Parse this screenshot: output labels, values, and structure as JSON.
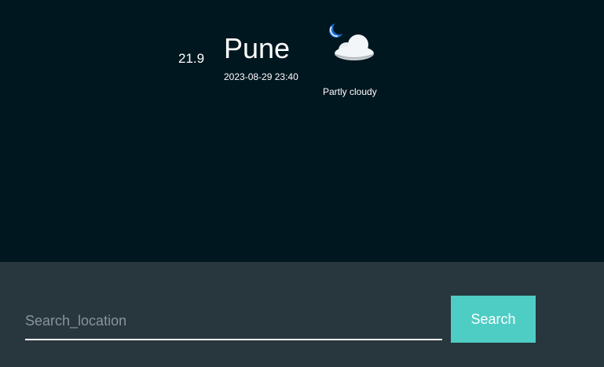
{
  "weather": {
    "temperature": "21.9",
    "city": "Pune",
    "datetime": "2023-08-29 23:40",
    "condition": "Partly cloudy",
    "icon": "partly-cloudy-night-icon"
  },
  "search": {
    "placeholder": "Search_location",
    "value": "",
    "button_label": "Search"
  },
  "colors": {
    "background_top": "#011720",
    "background_bottom": "#28363e",
    "button": "#4ecdc4",
    "text": "#ffffff"
  }
}
